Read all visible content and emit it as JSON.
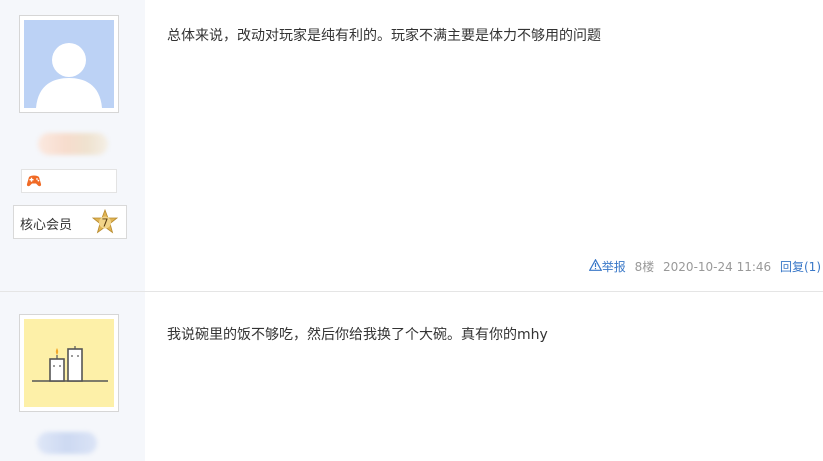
{
  "posts": [
    {
      "content": "总体来说，改动对玩家是纯有利的。玩家不满主要是体力不够用的问题",
      "rank": "核心会员",
      "level": "7",
      "meta": {
        "report_label": "举报",
        "floor": "8楼",
        "datetime": "2020-10-24 11:46",
        "reply_label": "回复(1)"
      }
    },
    {
      "content": "我说碗里的饭不够吃，然后你给我换了个大碗。真有你的mhy"
    }
  ],
  "icons": {
    "avatar_default": "default-user-avatar",
    "avatar_candles": "candles-illustration-avatar",
    "level_badge": "game-controller-icon",
    "report": "warning-triangle-icon",
    "member_star": "star-badge-icon"
  },
  "colors": {
    "link": "#3a78c8",
    "meta_gray": "#999999",
    "sidebar_bg": "#f5f7fb"
  }
}
